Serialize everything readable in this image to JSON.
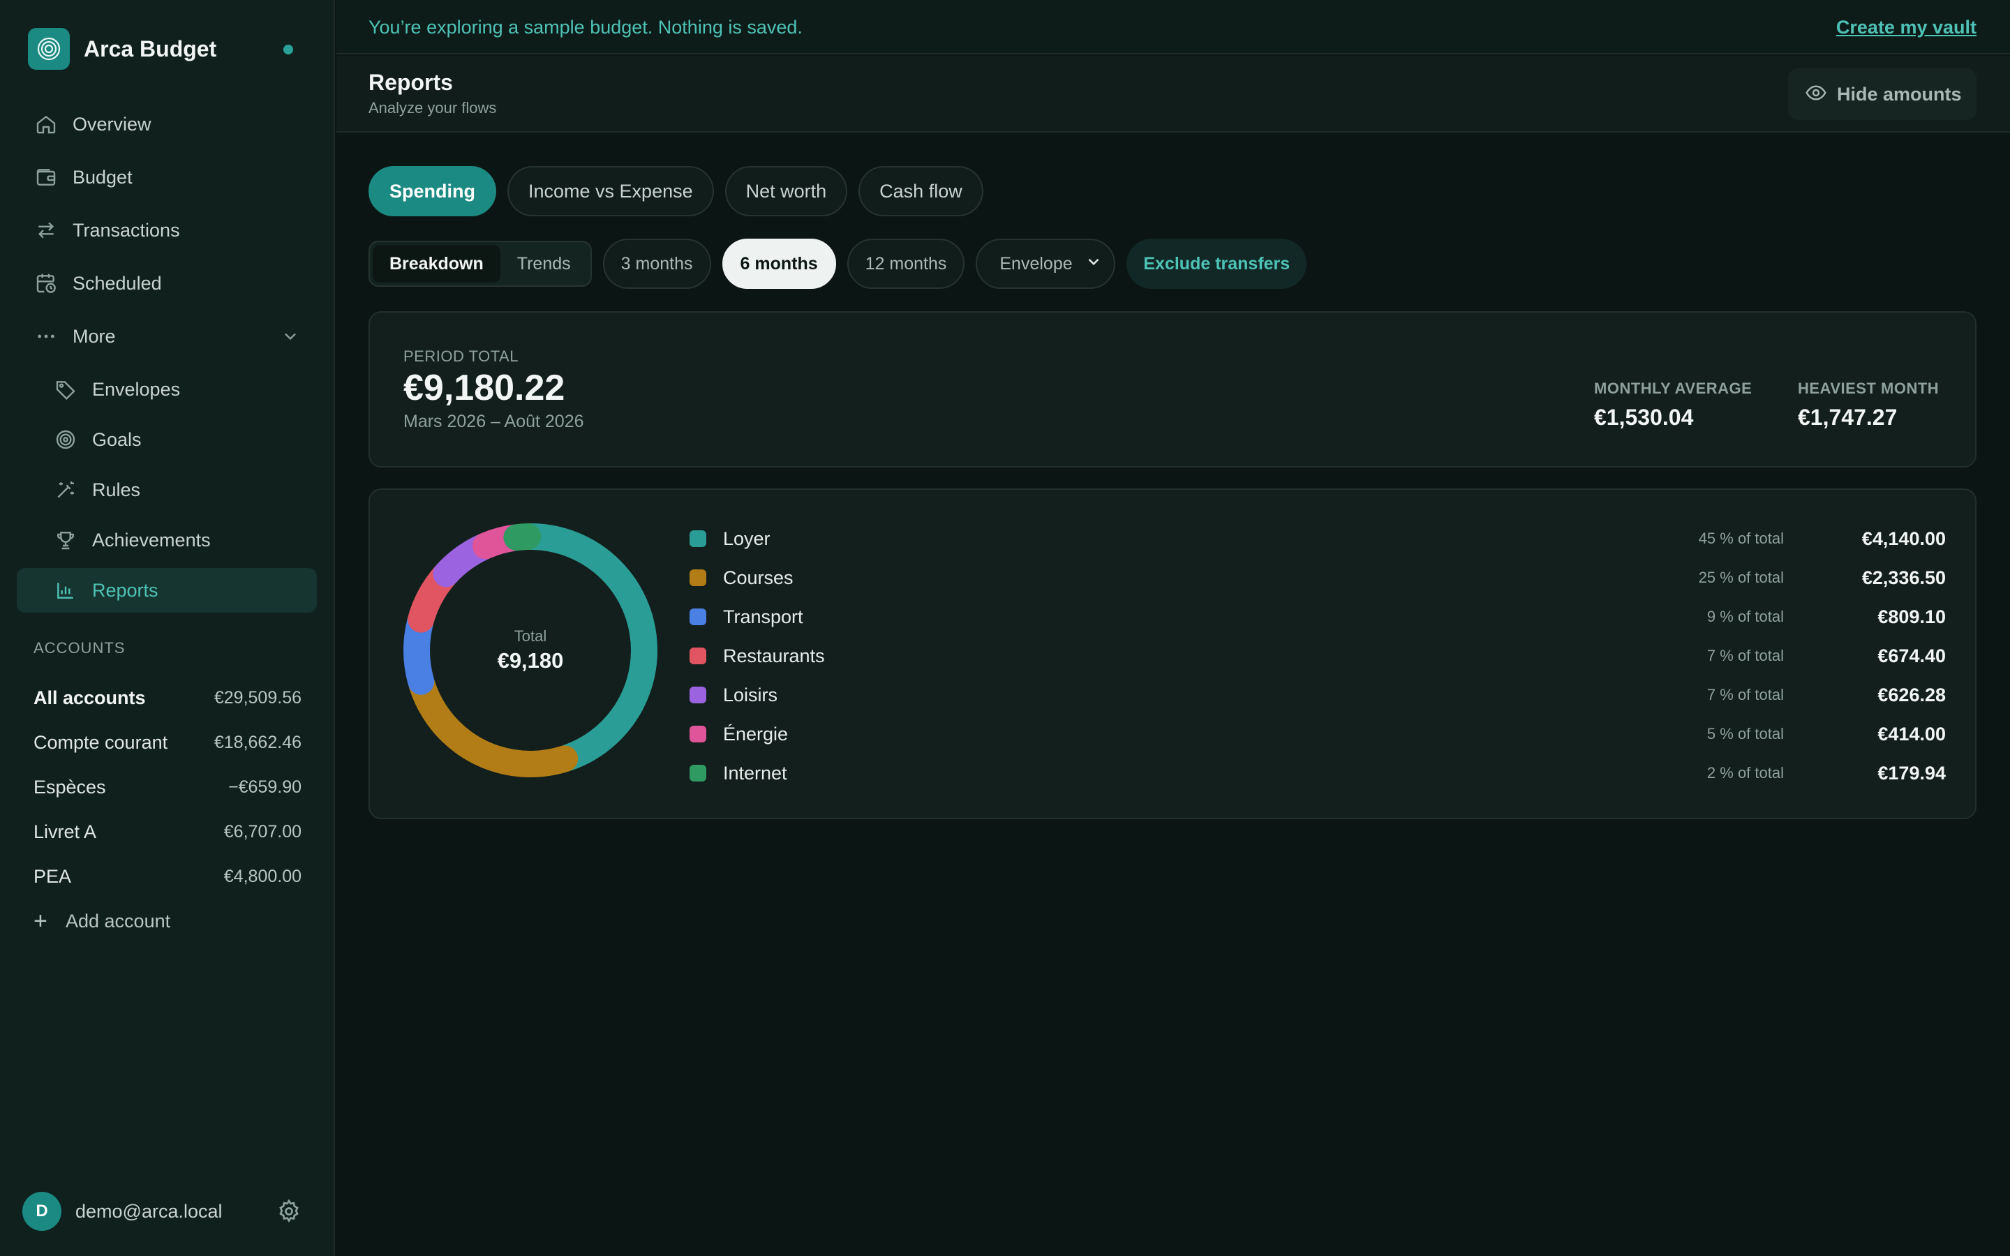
{
  "app": {
    "name": "Arca Budget"
  },
  "nav": {
    "items": [
      {
        "label": "Overview",
        "icon": "home-icon"
      },
      {
        "label": "Budget",
        "icon": "wallet-icon"
      },
      {
        "label": "Transactions",
        "icon": "arrows-icon"
      },
      {
        "label": "Scheduled",
        "icon": "calendar-clock-icon"
      },
      {
        "label": "More",
        "icon": "dots-icon"
      }
    ],
    "more_items": [
      {
        "label": "Envelopes",
        "icon": "tag-icon"
      },
      {
        "label": "Goals",
        "icon": "target-icon"
      },
      {
        "label": "Rules",
        "icon": "wand-icon"
      },
      {
        "label": "Achievements",
        "icon": "trophy-icon"
      },
      {
        "label": "Reports",
        "icon": "bar-chart-icon",
        "active": true
      }
    ]
  },
  "accounts": {
    "title": "ACCOUNTS",
    "rows": [
      {
        "name": "All accounts",
        "value": "€29,509.56"
      },
      {
        "name": "Compte courant",
        "value": "€18,662.46"
      },
      {
        "name": "Espèces",
        "value": "−€659.90"
      },
      {
        "name": "Livret A",
        "value": "€6,707.00"
      },
      {
        "name": "PEA",
        "value": "€4,800.00"
      }
    ],
    "add_label": "Add account"
  },
  "user": {
    "initial": "D",
    "email": "demo@arca.local"
  },
  "banner": {
    "message": "You’re exploring a sample budget. Nothing is saved.",
    "cta": "Create my vault"
  },
  "header": {
    "title": "Reports",
    "subtitle": "Analyze your flows",
    "hide_label": "Hide amounts"
  },
  "tabs": [
    "Spending",
    "Income vs Expense",
    "Net worth",
    "Cash flow"
  ],
  "filters": {
    "views": [
      "Breakdown",
      "Trends"
    ],
    "periods": [
      "3 months",
      "6 months",
      "12 months"
    ],
    "selected_period": "6 months",
    "group_by": "Envelope",
    "exclude_label": "Exclude transfers"
  },
  "summary": {
    "label": "PERIOD TOTAL",
    "total": "€9,180.22",
    "range": "Mars 2026 – Août 2026",
    "monthly_avg_label": "MONTHLY AVERAGE",
    "monthly_avg": "€1,530.04",
    "heaviest_label": "HEAVIEST MONTH",
    "heaviest": "€1,747.27"
  },
  "chart_data": {
    "type": "pie",
    "center_label": "Total",
    "center_value": "€9,180",
    "categories": [
      "Loyer",
      "Courses",
      "Transport",
      "Restaurants",
      "Loisirs",
      "Énergie",
      "Internet"
    ],
    "values": [
      4140.0,
      2336.5,
      809.1,
      674.4,
      626.28,
      414.0,
      179.94
    ],
    "amounts": [
      "€4,140.00",
      "€2,336.50",
      "€809.10",
      "€674.40",
      "€626.28",
      "€414.00",
      "€179.94"
    ],
    "percents": [
      "45 % of total",
      "25 % of total",
      "9 % of total",
      "7 % of total",
      "7 % of total",
      "5 % of total",
      "2 % of total"
    ],
    "colors": [
      "#2a9d97",
      "#b27d16",
      "#4a7fe3",
      "#e05561",
      "#9b63e0",
      "#e0559a",
      "#2f9a62"
    ]
  }
}
